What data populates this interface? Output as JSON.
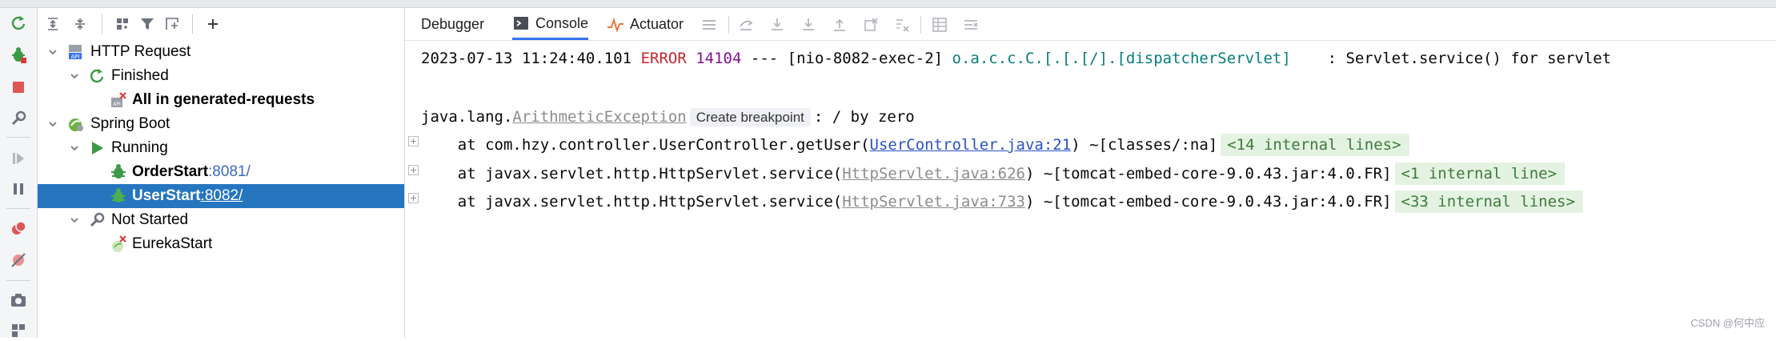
{
  "tree_panel": {
    "items": [
      {
        "label": "HTTP Request"
      },
      {
        "label": "Finished"
      },
      {
        "label": "All in generated-requests"
      },
      {
        "label": "Spring Boot"
      },
      {
        "label": "Running"
      },
      {
        "label": "OrderStart",
        "port": ":8081/"
      },
      {
        "label": "UserStart",
        "port": ":8082/",
        "selected": true
      },
      {
        "label": "Not Started"
      },
      {
        "label": "EurekaStart"
      }
    ]
  },
  "tabs": [
    {
      "label": "Debugger"
    },
    {
      "label": "Console",
      "active": true
    },
    {
      "label": "Actuator"
    }
  ],
  "console": {
    "log_line": {
      "timestamp": "2023-07-13 11:24:40.101",
      "level": "ERROR",
      "pid": "14104",
      "thread": "--- [nio-8082-exec-2]",
      "logger": "o.a.c.c.C.[.[.[/].[dispatcherServlet]",
      "message": "   : Servlet.service() for servlet"
    },
    "exception": {
      "prefix": "java.lang.",
      "class": "ArithmeticException",
      "breakpoint": "Create breakpoint",
      "message": ": / by zero"
    },
    "frames": [
      {
        "at": "    at com.hzy.controller.UserController.getUser(",
        "link": "UserController.java:21",
        "after": ") ~[classes/:na]",
        "folded": "<14 internal lines>",
        "link_style": "link"
      },
      {
        "at": "    at javax.servlet.http.HttpServlet.service(",
        "link": "HttpServlet.java:626",
        "after": ") ~[tomcat-embed-core-9.0.43.jar:4.0.FR]",
        "folded": "<1 internal line>",
        "link_style": "grey"
      },
      {
        "at": "    at javax.servlet.http.HttpServlet.service(",
        "link": "HttpServlet.java:733",
        "after": ") ~[tomcat-embed-core-9.0.43.jar:4.0.FR]",
        "folded": "<33 internal lines>",
        "link_style": "grey"
      }
    ]
  },
  "watermark": "CSDN @何中应",
  "colors": {
    "selection": "#2675bf",
    "error": "#c7222d",
    "link": "#2a51c7",
    "fold_bg": "#e4f3e1",
    "run_green": "#3b9a45"
  },
  "icons": {
    "leftbar": [
      "rerun-icon",
      "debug-config-icon",
      "stop-icon",
      "settings-wrench-icon",
      "resume-icon",
      "pause-icon",
      "view-breakpoints-icon",
      "mute-breakpoints-icon",
      "camera-icon",
      "layout-icon"
    ]
  }
}
